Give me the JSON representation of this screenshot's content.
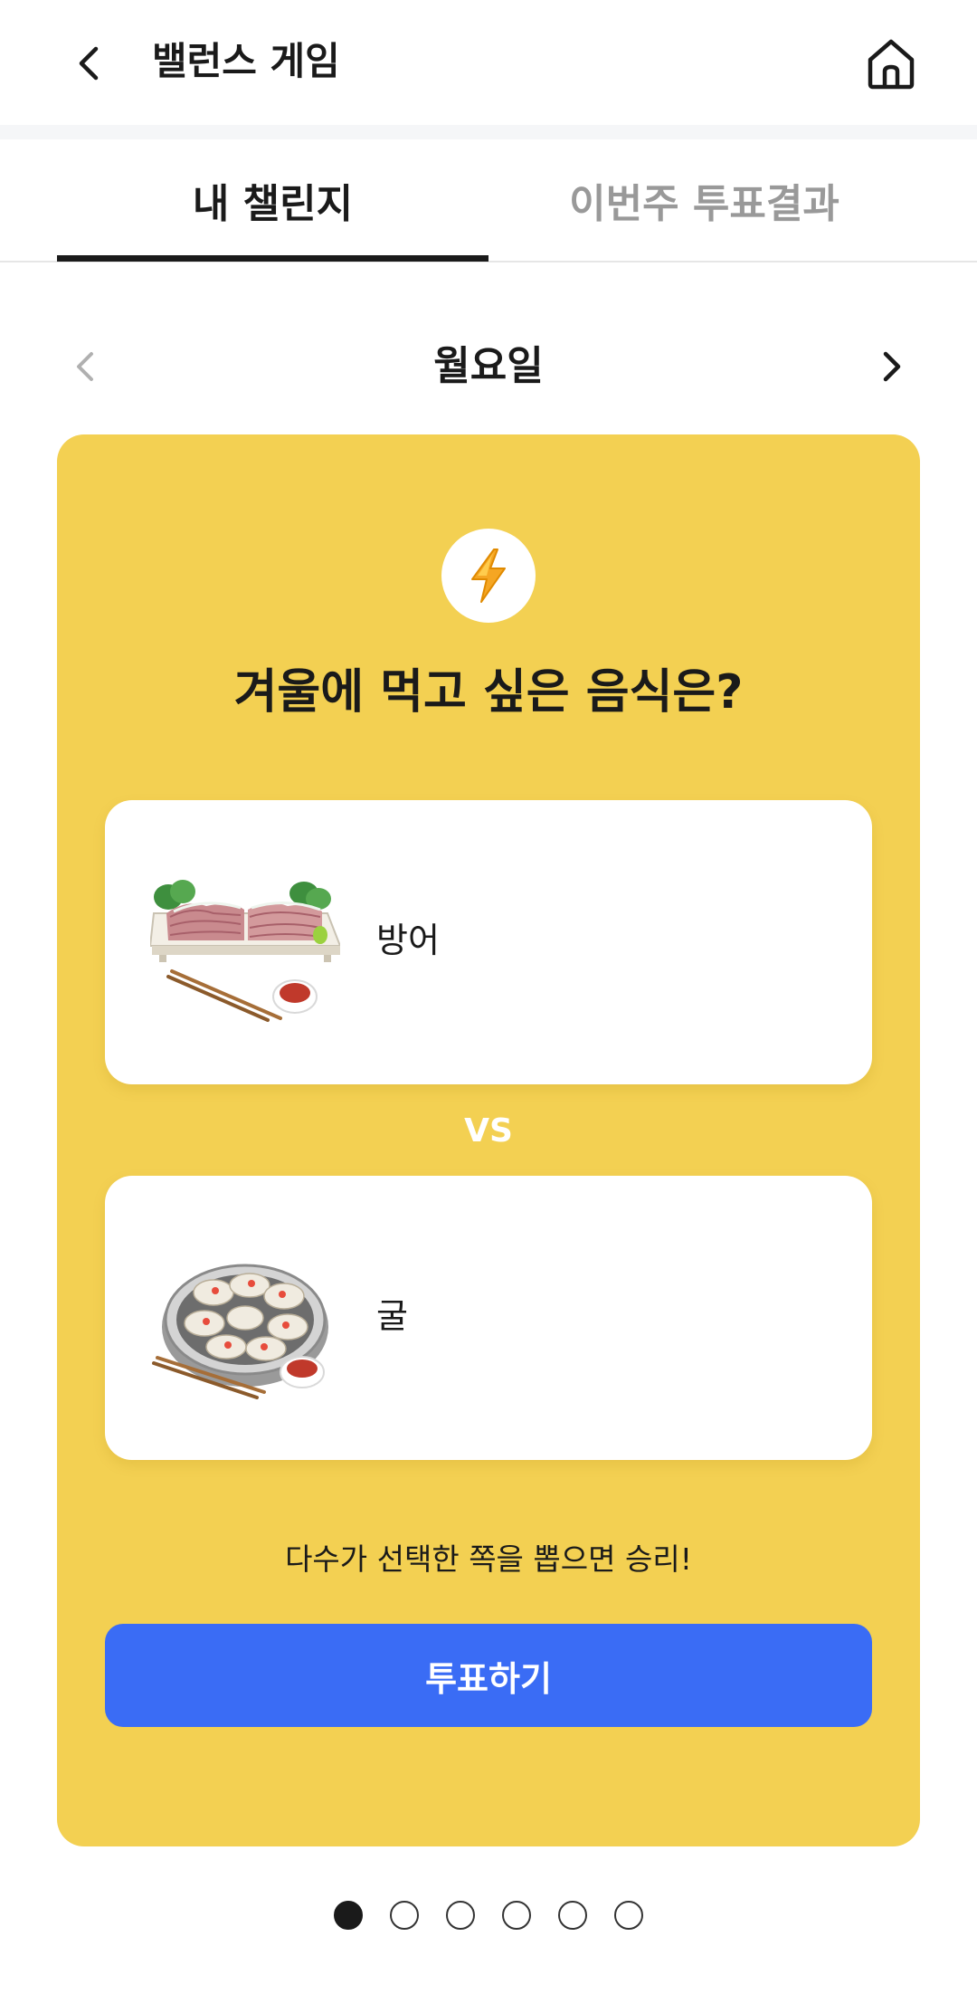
{
  "header": {
    "title": "밸런스 게임",
    "back_icon": "chevron-left-icon",
    "home_icon": "home-icon"
  },
  "tabs": [
    {
      "label": "내 챌린지",
      "active": true
    },
    {
      "label": "이번주 투표결과",
      "active": false
    }
  ],
  "day_nav": {
    "day": "월요일",
    "prev_enabled": false,
    "next_enabled": true
  },
  "card": {
    "background_color": "#f3d052",
    "badge_icon": "lightning-bolt-icon",
    "question": "겨울에 먹고 싶은 음식은?",
    "options": [
      {
        "label": "방어",
        "image": "yellowtail-sashimi-image"
      },
      {
        "label": "굴",
        "image": "oysters-image"
      }
    ],
    "vs_label": "VS",
    "hint": "다수가 선택한 쪽을 뽑으면 승리!",
    "vote_button": "투표하기",
    "vote_button_color": "#3a6cf5"
  },
  "pagination": {
    "total": 6,
    "current": 1
  }
}
